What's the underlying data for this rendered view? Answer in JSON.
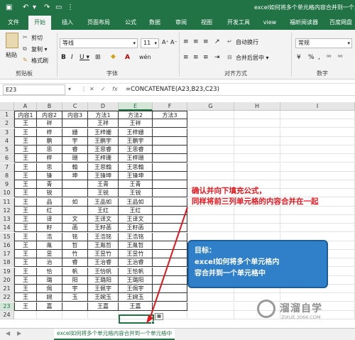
{
  "titlebar": {
    "doc_title": "excel如何将多个单元格内容合并到一个单",
    "icons": [
      "save-icon",
      "undo-icon",
      "redo-icon",
      "customize-icon"
    ]
  },
  "tabs": [
    "文件",
    "开始",
    "插入",
    "页面布局",
    "公式",
    "数据",
    "审阅",
    "视图",
    "开发工具",
    "view",
    "福昕阅读器",
    "百度网盘"
  ],
  "active_tab": "开始",
  "ribbon": {
    "clipboard": {
      "paste": "粘贴",
      "cut": "剪切",
      "copy": "复制 ▾",
      "format_painter": "格式刷",
      "label": "剪贴板"
    },
    "font": {
      "name": "等线",
      "size": "11",
      "label": "字体",
      "bold": "B",
      "italic": "I",
      "underline": "U ▾",
      "grow": "A⁺",
      "shrink": "A⁻",
      "wen": "wén"
    },
    "alignment": {
      "wrap": "自动换行",
      "merge": "合并后居中 ▾",
      "label": "对齐方式"
    },
    "number": {
      "format": "常规",
      "percent": "%",
      "comma": ",",
      "label": "数字"
    }
  },
  "formula_bar": {
    "cell_ref": "E23",
    "fx": "fx",
    "formula": "=CONCATENATE(A23,B23,C23)"
  },
  "columns": [
    "A",
    "B",
    "C",
    "D",
    "E",
    "F",
    "G",
    "H",
    "I"
  ],
  "rows": [
    [
      "内容1",
      "内容2",
      "内容3",
      "方法1",
      "方法2",
      "方法3"
    ],
    [
      "王",
      "祥",
      "",
      "王祥",
      "王祥",
      ""
    ],
    [
      "王",
      "梓",
      "姗",
      "王梓姗",
      "王梓姗",
      ""
    ],
    [
      "王",
      "鹏",
      "宇",
      "王鹏宇",
      "王鹏宇",
      ""
    ],
    [
      "王",
      "思",
      "睿",
      "王思睿",
      "王思睿",
      ""
    ],
    [
      "王",
      "梓",
      "珊",
      "王梓珊",
      "王梓珊",
      ""
    ],
    [
      "王",
      "思",
      "翰",
      "王思翰",
      "王思翰",
      ""
    ],
    [
      "王",
      "锋",
      "坤",
      "王锋坤",
      "王锋坤",
      ""
    ],
    [
      "王",
      "青",
      "",
      "王青",
      "王青",
      ""
    ],
    [
      "王",
      "锐",
      "",
      "王锐",
      "王锐",
      ""
    ],
    [
      "王",
      "品",
      "如",
      "王品如",
      "王品如",
      ""
    ],
    [
      "王",
      "红",
      "",
      "王红",
      "王红",
      ""
    ],
    [
      "王",
      "译",
      "文",
      "王译文",
      "王译文",
      ""
    ],
    [
      "王",
      "籽",
      "菡",
      "王籽菡",
      "王籽菡",
      ""
    ],
    [
      "王",
      "浩",
      "铭",
      "王浩铭",
      "王浩铭",
      ""
    ],
    [
      "王",
      "胤",
      "哲",
      "王胤哲",
      "王胤哲",
      ""
    ],
    [
      "王",
      "昱",
      "竹",
      "王昱竹",
      "王昱竹",
      ""
    ],
    [
      "王",
      "治",
      "睿",
      "王治睿",
      "王治睿",
      ""
    ],
    [
      "王",
      "恰",
      "帆",
      "王恰帆",
      "王恰帆",
      ""
    ],
    [
      "王",
      "璐",
      "阳",
      "王璐阳",
      "王璐阳",
      ""
    ],
    [
      "王",
      "佩",
      "宇",
      "王佩宇",
      "王佩宇",
      ""
    ],
    [
      "王",
      "婉",
      "玉",
      "王婉玉",
      "王婉玉",
      ""
    ],
    [
      "王",
      "嘉",
      "",
      "王嘉",
      "王嘉",
      ""
    ],
    [
      "",
      "",
      "",
      "",
      "",
      ""
    ]
  ],
  "annotations": {
    "instruction_line1": "确认并向下填充公式，",
    "instruction_line2": "同样将前三列单元格的内容合并在一起",
    "goal_title": "目标：",
    "goal_line1": "excel如何将多个单元格内",
    "goal_line2": "容合并到一个单元格中"
  },
  "watermark": {
    "name": "溜溜自学",
    "url": "ZIXUE.3066.COM"
  },
  "sheet_tab": "excel如何将多个单元格内容合并到一个单元格中",
  "colors": {
    "excel_green": "#217346",
    "annotation_red": "#e8141b",
    "goal_blue": "#2f7fc9"
  }
}
